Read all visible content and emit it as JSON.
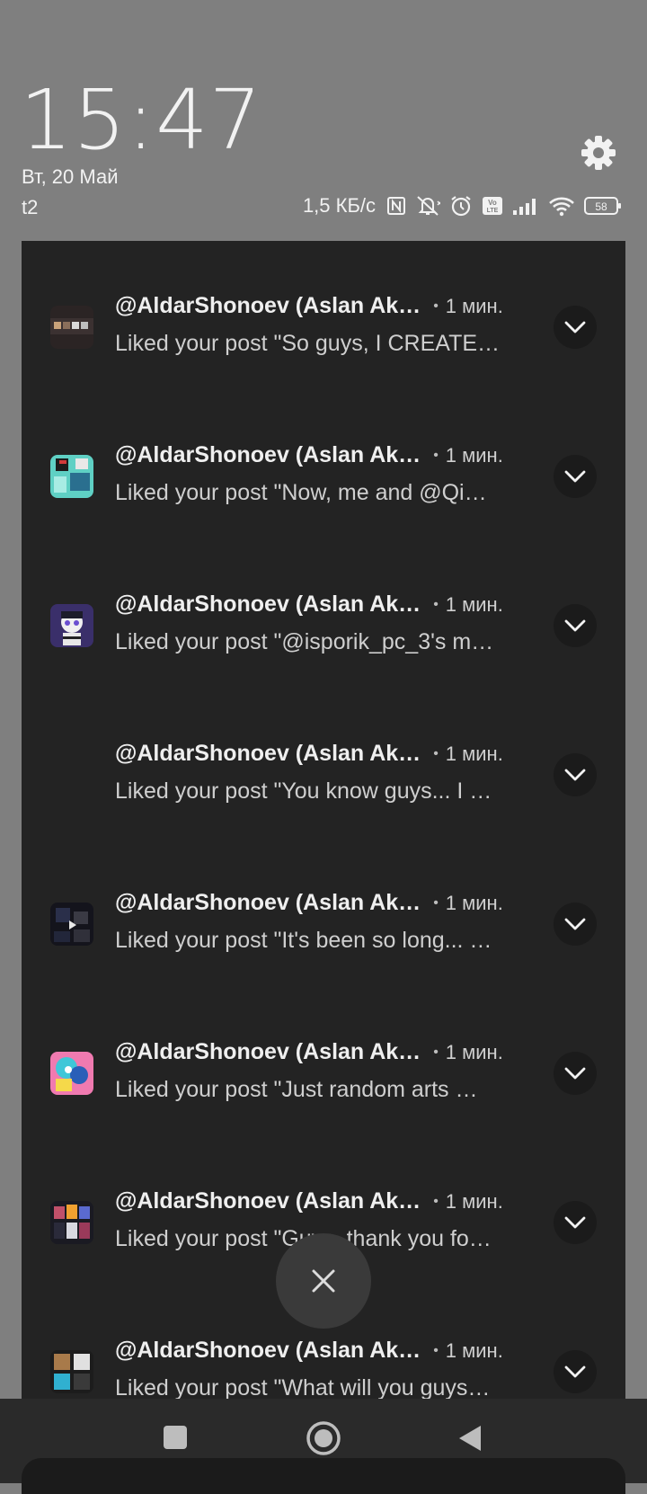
{
  "status_bar": {
    "time": "15:47",
    "date": "Вт, 20 Май",
    "carrier": "t2",
    "network_speed": "1,5 КБ/с",
    "battery": "58",
    "volte_top": "Vo",
    "volte_bottom": "LTE",
    "icons": [
      "nfc-icon",
      "mute-icon",
      "alarm-icon",
      "volte-icon",
      "signal-icon",
      "wifi-icon",
      "battery-icon"
    ]
  },
  "notifications": [
    {
      "sender": "@AldarShonoev (Aslan Ak…",
      "separator": "•",
      "time": "1 мин.",
      "text": "Liked your post \"So guys, I CREATE…"
    },
    {
      "sender": "@AldarShonoev (Aslan Ak…",
      "separator": "•",
      "time": "1 мин.",
      "text": "Liked your post \"Now, me and @Qi…"
    },
    {
      "sender": "@AldarShonoev (Aslan Ak…",
      "separator": "•",
      "time": "1 мин.",
      "text": "Liked your post \"@isporik_pc_3's m…"
    },
    {
      "sender": "@AldarShonoev (Aslan Ak…",
      "separator": "•",
      "time": "1 мин.",
      "text": "Liked your post \"You know guys... I …"
    },
    {
      "sender": "@AldarShonoev (Aslan Ak…",
      "separator": "•",
      "time": "1 мин.",
      "text": "Liked your post \"It's been so long... …"
    },
    {
      "sender": "@AldarShonoev (Aslan Ak…",
      "separator": "•",
      "time": "1 мин.",
      "text": "Liked your post \"Just random arts …"
    },
    {
      "sender": "@AldarShonoev (Aslan Ak…",
      "separator": "•",
      "time": "1 мин.",
      "text": "Liked your post \"Guys, thank you fo…"
    },
    {
      "sender": "@AldarShonoev (Aslan Ak…",
      "separator": "•",
      "time": "1 мин.",
      "text": "Liked your post \"What will you guys…"
    }
  ],
  "colors": {
    "wallpaper": "#7f7f7f",
    "shade": "#232323",
    "text_primary": "#efefef",
    "text_secondary": "#cfcfcf"
  }
}
